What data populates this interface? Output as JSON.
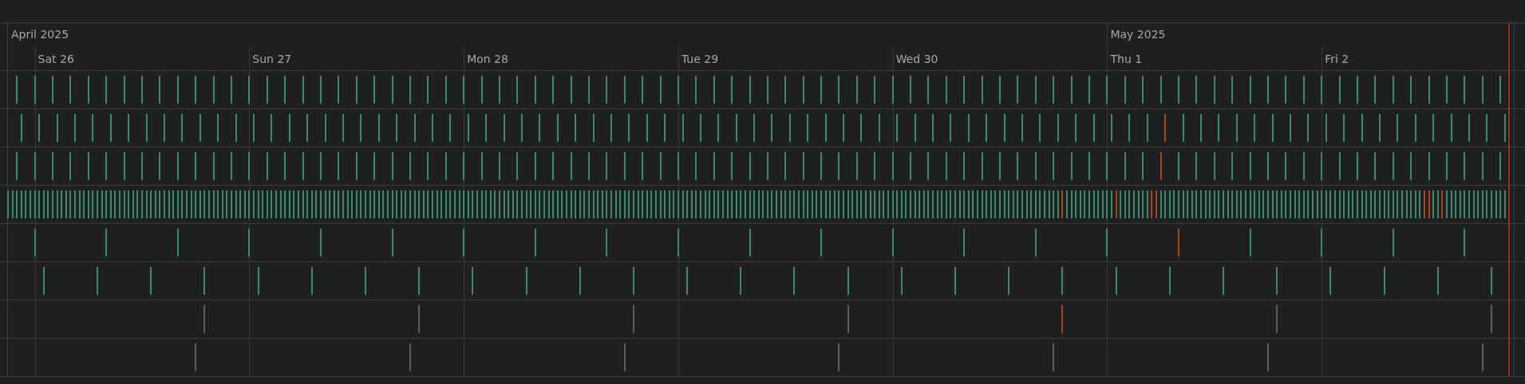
{
  "timeline": {
    "months": [
      {
        "label": "April 2025",
        "days": [
          {
            "label": "Sat 26"
          },
          {
            "label": "Sun 27"
          },
          {
            "label": "Mon 28"
          },
          {
            "label": "Tue 29"
          },
          {
            "label": "Wed 30"
          }
        ]
      },
      {
        "label": "May 2025",
        "days": [
          {
            "label": "Thu 1"
          },
          {
            "label": "Fri 2"
          }
        ]
      }
    ],
    "rows": [
      {
        "paused": false,
        "failed": [
          false,
          false,
          false,
          false,
          false,
          false,
          false,
          false,
          false,
          false,
          false,
          false,
          false,
          false,
          false,
          false,
          false,
          false,
          false,
          false,
          false,
          false,
          false,
          false,
          false,
          false,
          false,
          false,
          false,
          false,
          false,
          false,
          false,
          false,
          false,
          false,
          false,
          false,
          false,
          false,
          false,
          false,
          false,
          false,
          false,
          false,
          false,
          false,
          false,
          false,
          false,
          false,
          false,
          false,
          false,
          false,
          false,
          false,
          false,
          false,
          false,
          false,
          false,
          false,
          false,
          false,
          false,
          false,
          false,
          false,
          false,
          false,
          false,
          false,
          false,
          false,
          false,
          false,
          false,
          false,
          false,
          false,
          false,
          false
        ]
      },
      {
        "paused": false,
        "failed": [
          false,
          false,
          false,
          false,
          false,
          false,
          false,
          false,
          false,
          false,
          false,
          false,
          false,
          false,
          false,
          false,
          false,
          false,
          false,
          false,
          false,
          false,
          false,
          false,
          false,
          false,
          false,
          false,
          false,
          false,
          false,
          false,
          false,
          false,
          false,
          false,
          false,
          false,
          false,
          false,
          false,
          false,
          false,
          false,
          false,
          false,
          false,
          false,
          false,
          false,
          false,
          false,
          false,
          false,
          false,
          false,
          false,
          false,
          false,
          false,
          false,
          false,
          false,
          false,
          true,
          false,
          false,
          false,
          false,
          false,
          false,
          false,
          false,
          false,
          false,
          false,
          false,
          false,
          false,
          false,
          false,
          false,
          false,
          false
        ]
      },
      {
        "paused": false,
        "failed": [
          false,
          false,
          false,
          false,
          false,
          false,
          false,
          false,
          false,
          false,
          false,
          false,
          false,
          false,
          false,
          false,
          false,
          false,
          false,
          false,
          false,
          false,
          false,
          false,
          false,
          false,
          false,
          false,
          false,
          false,
          false,
          false,
          false,
          false,
          false,
          false,
          false,
          false,
          false,
          false,
          false,
          false,
          false,
          false,
          false,
          false,
          false,
          false,
          false,
          false,
          false,
          false,
          false,
          false,
          false,
          false,
          false,
          false,
          false,
          false,
          false,
          false,
          false,
          false,
          true,
          false,
          false,
          false,
          false,
          false,
          false,
          false,
          false,
          false,
          false,
          false,
          false,
          false,
          false,
          false,
          false,
          false,
          false,
          false
        ]
      },
      {
        "paused": false,
        "failed": [
          false,
          false,
          false,
          false,
          false,
          false,
          false,
          false,
          false,
          false,
          false,
          false,
          false,
          false,
          false,
          false,
          false,
          false,
          false,
          false,
          false,
          false,
          false,
          false,
          false,
          false,
          false,
          false,
          false,
          false,
          false,
          false,
          false,
          false,
          false,
          false,
          false,
          false,
          false,
          false,
          false,
          false,
          false,
          false,
          false,
          false,
          false,
          false,
          false,
          false,
          false,
          false,
          false,
          false,
          false,
          false,
          false,
          false,
          false,
          false,
          false,
          false,
          false,
          false,
          false,
          false,
          false,
          false,
          false,
          false,
          false,
          false,
          false,
          false,
          false,
          false,
          false,
          false,
          false,
          false,
          false,
          false,
          false,
          false,
          false,
          false,
          false,
          false,
          false,
          false,
          false,
          false,
          false,
          false,
          false,
          false,
          false,
          false,
          false,
          false,
          false,
          false,
          false,
          false,
          false,
          false,
          false,
          false,
          false,
          false,
          false,
          false,
          false,
          false,
          false,
          false,
          false,
          false,
          false,
          false,
          false,
          false,
          false,
          false,
          false,
          false,
          false,
          false,
          false,
          false,
          false,
          false,
          false,
          false,
          false,
          false,
          false,
          false,
          false,
          false,
          false,
          false,
          false,
          false,
          false,
          false,
          false,
          false,
          false,
          false,
          false,
          false,
          false,
          false,
          false,
          false,
          false,
          false,
          false,
          false,
          false,
          false,
          false,
          false,
          false,
          false,
          false,
          false,
          false,
          false,
          false,
          false,
          false,
          false,
          false,
          false,
          false,
          false,
          false,
          false,
          false,
          false,
          false,
          false,
          false,
          false,
          false,
          false,
          false,
          false,
          false,
          false,
          false,
          false,
          false,
          false,
          false,
          false,
          false,
          false,
          false,
          false,
          false,
          false,
          false,
          false,
          false,
          false,
          false,
          false,
          false,
          false,
          false,
          false,
          false,
          false,
          false,
          false,
          false,
          false,
          false,
          false,
          false,
          false,
          false,
          false,
          false,
          false,
          false,
          false,
          false,
          false,
          false,
          false,
          false,
          false,
          true,
          false,
          false,
          false,
          false,
          false,
          false,
          false,
          false,
          false,
          false,
          false,
          true,
          false,
          false,
          false,
          false,
          false,
          false,
          false,
          true,
          true,
          false,
          false,
          false,
          false,
          false,
          false,
          false,
          false,
          false,
          false,
          false,
          false,
          false,
          false,
          false,
          false,
          false,
          false,
          false,
          false,
          false,
          false,
          false,
          false,
          false,
          false,
          false,
          false,
          false,
          false,
          false,
          false,
          false,
          false,
          false,
          false,
          false,
          false,
          false,
          false,
          false,
          false,
          false,
          false,
          false,
          false,
          false,
          false,
          false,
          false,
          false,
          false,
          false,
          false,
          false,
          false,
          false,
          false,
          false,
          true,
          true,
          false,
          false,
          true,
          false,
          false,
          false,
          false,
          false,
          false,
          false,
          false,
          false,
          false,
          false,
          false,
          false,
          false
        ]
      },
      {
        "paused": false,
        "failed": [
          false,
          false,
          false,
          false,
          false,
          false,
          false,
          false,
          false,
          false,
          false,
          false,
          false,
          false,
          false,
          false,
          true,
          false,
          false,
          false,
          false
        ]
      },
      {
        "paused": false,
        "failed": [
          false,
          false,
          false,
          false,
          false,
          false,
          false,
          false,
          false,
          false,
          false,
          false,
          false,
          false,
          false,
          false,
          false,
          false,
          false,
          false,
          false,
          false,
          false,
          false,
          false,
          false,
          false,
          false
        ]
      },
      {
        "paused": true,
        "failed": [
          false,
          false,
          false,
          false,
          true,
          false,
          false
        ]
      },
      {
        "paused": true,
        "failed": [
          false,
          false,
          false,
          false,
          false,
          false,
          false
        ]
      }
    ]
  }
}
